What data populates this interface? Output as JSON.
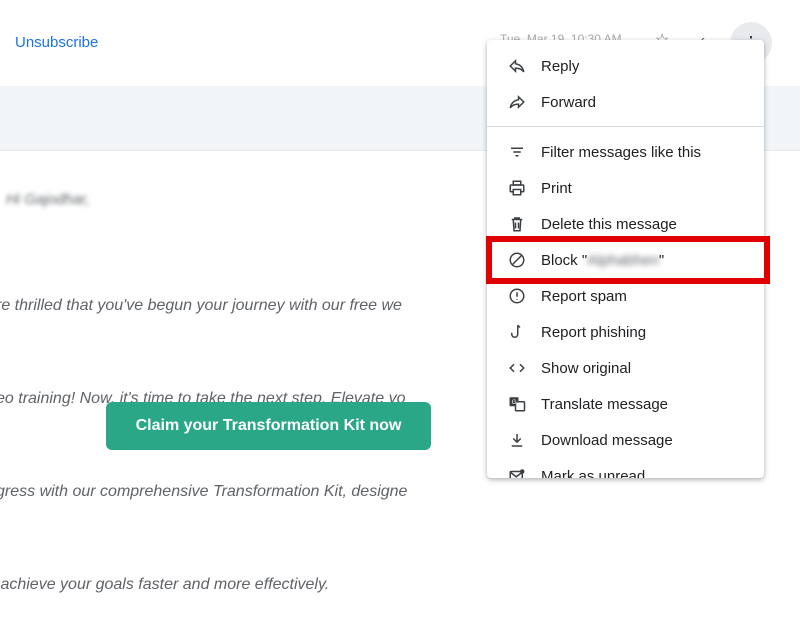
{
  "email": {
    "unsubscribe_label": "Unsubscribe",
    "date_text": "Tue, Mar 19, 10:30 AM",
    "greeting": "Hi Gajodhar,",
    "body_lines": [
      "re thrilled that you've begun your journey with our free we",
      "eo training! Now, it's time to take the next step. Elevate yo",
      "gress with our comprehensive Transformation Kit, designe",
      " achieve your goals faster and more effectively."
    ],
    "cta_label": "Claim your Transformation Kit now"
  },
  "menu": {
    "items": [
      {
        "label": "Reply",
        "icon": "reply-icon"
      },
      {
        "label": "Forward",
        "icon": "forward-icon"
      },
      {
        "label": "Filter messages like this",
        "icon": "filter-icon"
      },
      {
        "label": "Print",
        "icon": "print-icon"
      },
      {
        "label": "Delete this message",
        "icon": "trash-icon"
      },
      {
        "label": "Block \"",
        "sender": "Alphabhen",
        "label_end": "\"",
        "icon": "block-icon"
      },
      {
        "label": "Report spam",
        "icon": "report-spam-icon"
      },
      {
        "label": "Report phishing",
        "icon": "phishing-hook-icon"
      },
      {
        "label": "Show original",
        "icon": "code-icon"
      },
      {
        "label": "Translate message",
        "icon": "translate-icon"
      },
      {
        "label": "Download message",
        "icon": "download-icon"
      },
      {
        "label": "Mark as unread",
        "icon": "mark-unread-icon"
      }
    ]
  },
  "colors": {
    "highlight_border": "#e00000",
    "cta_background": "#29a787",
    "link": "#1a73e8"
  }
}
